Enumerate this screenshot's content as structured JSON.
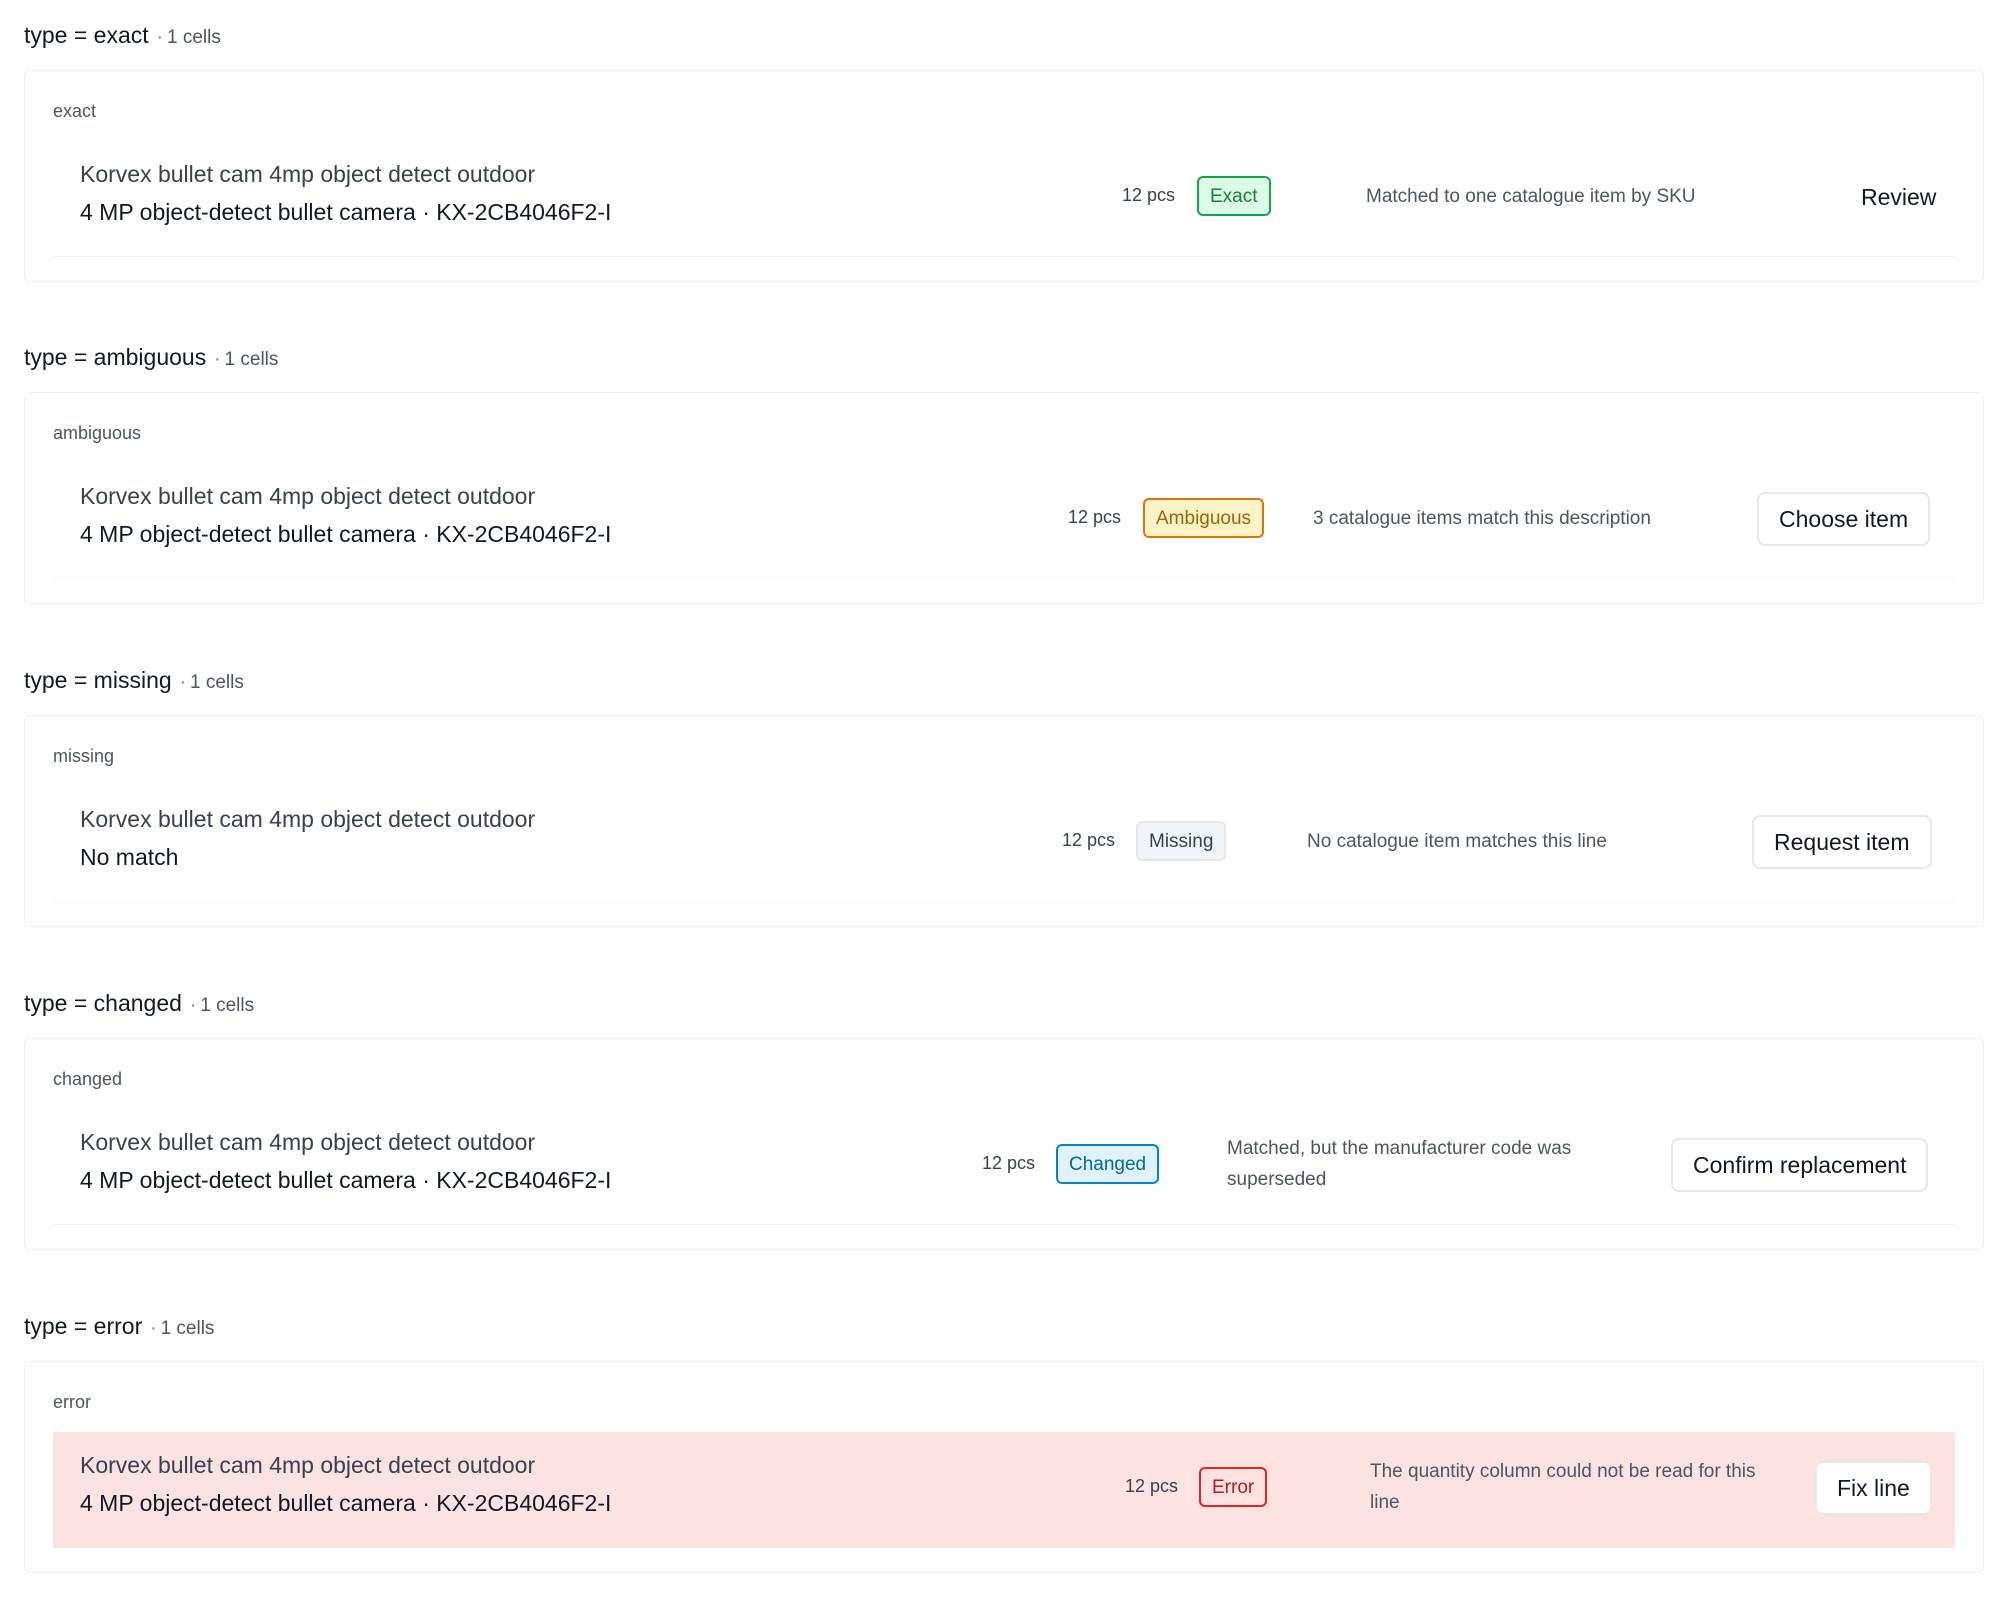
{
  "groups": [
    {
      "key": "exact",
      "title": "type = exact",
      "count": "1 cells",
      "cell_label": "exact",
      "row": {
        "primary": "Korvex bullet cam 4mp object detect outdoor",
        "secondary": "4 MP object-detect bullet camera · KX-2CB4046F2-I",
        "qty": "12 pcs",
        "badge": "Exact",
        "note": "Matched to one catalogue item by SKU",
        "action": "Review"
      }
    },
    {
      "key": "ambiguous",
      "title": "type = ambiguous",
      "count": "1 cells",
      "cell_label": "ambiguous",
      "row": {
        "primary": "Korvex bullet cam 4mp object detect outdoor",
        "secondary": "4 MP object-detect bullet camera · KX-2CB4046F2-I",
        "qty": "12 pcs",
        "badge": "Ambiguous",
        "note": "3 catalogue items match this description",
        "action": "Choose item"
      }
    },
    {
      "key": "missing",
      "title": "type = missing",
      "count": "1 cells",
      "cell_label": "missing",
      "row": {
        "primary": "Korvex bullet cam 4mp object detect outdoor",
        "secondary": "No match",
        "qty": "12 pcs",
        "badge": "Missing",
        "note": "No catalogue item matches this line",
        "action": "Request item"
      }
    },
    {
      "key": "changed",
      "title": "type = changed",
      "count": "1 cells",
      "cell_label": "changed",
      "row": {
        "primary": "Korvex bullet cam 4mp object detect outdoor",
        "secondary": "4 MP object-detect bullet camera · KX-2CB4046F2-I",
        "qty": "12 pcs",
        "badge": "Changed",
        "note": "Matched, but the manufacturer code was superseded",
        "action": "Confirm replacement"
      }
    },
    {
      "key": "error",
      "title": "type = error",
      "count": "1 cells",
      "cell_label": "error",
      "row": {
        "primary": "Korvex bullet cam 4mp object detect outdoor",
        "secondary": "4 MP object-detect bullet camera · KX-2CB4046F2-I",
        "qty": "12 pcs",
        "badge": "Error",
        "note": "The quantity column could not be read for this line",
        "action": "Fix line"
      }
    }
  ],
  "colors": {
    "exact": "#16a34a",
    "ambiguous": "#d97706",
    "missing": "#e5e7eb",
    "changed": "#0284c7",
    "error": "#dc2626",
    "error_row_bg": "#fde2e2"
  }
}
